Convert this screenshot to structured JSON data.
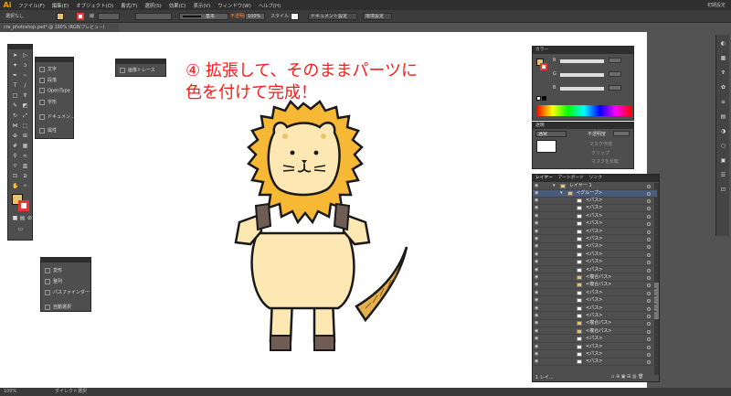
{
  "app": {
    "logo": "Ai",
    "menus": [
      "ファイル(F)",
      "編集(E)",
      "オブジェクト(O)",
      "書式(T)",
      "選択(S)",
      "効果(C)",
      "表示(V)",
      "ウィンドウ(W)",
      "ヘルプ(H)"
    ],
    "workspace": "初期設定"
  },
  "control": {
    "selection_label": "選択なし",
    "stroke_label": "線",
    "style_preset": "基本",
    "opacity_label": "不透明度",
    "opacity_value": "100%",
    "style_label": "スタイル：",
    "doc_settings": "ドキュメント設定",
    "env_settings": "環境設定"
  },
  "document": {
    "tab": "cre_photoshop.psd* @ 100% (RGB/プレビュー)"
  },
  "status": {
    "zoom": "100%",
    "tool": "ダイレクト選択"
  },
  "overlay": {
    "line1": "④ 拡張して、そのままパーツに",
    "line2": "色を付けて完成！"
  },
  "panels": {
    "type_panel": [
      "文字",
      "段落",
      "OpenType",
      "字形",
      "ドキュメン...",
      "属性"
    ],
    "trace_panel": "画像トレース",
    "transform_panel": [
      "変形",
      "整列",
      "パスファインダー",
      "自動選択"
    ],
    "color_tab": "カラー",
    "color_fields": [
      "R",
      "G",
      "B"
    ],
    "transparency_tab": "透明",
    "blend_mode": "通常",
    "opacity_label": "不透明度",
    "mask_button": "マスク作成",
    "clip_label": "クリップ",
    "invert_label": "マスクを反転",
    "layers_tabs": [
      "レイヤー",
      "アートボード",
      "リンク"
    ],
    "layer_top": "レイヤー 1",
    "group": "<グループ>",
    "layer_items": [
      "<パス>",
      "<パス>",
      "<パス>",
      "<パス>",
      "<パス>",
      "<パス>",
      "<パス>",
      "<パス>",
      "<パス>",
      "<パス>",
      "<複合パス>",
      "<複合パス>",
      "<パス>",
      "<パス>",
      "<パス>",
      "<パス>",
      "<複合パス>",
      "<複合パス>",
      "<パス>",
      "<パス>",
      "<パス>",
      "<パス>"
    ],
    "layers_count": "1 レイ..."
  },
  "colors": {
    "lion_mane": "#f7b935",
    "lion_face": "#fde8b4",
    "lion_body": "#fde8b4",
    "lion_paw": "#6f5c55",
    "lion_tail": "#e4b04c",
    "overlay_text": "#ff1a1a"
  }
}
